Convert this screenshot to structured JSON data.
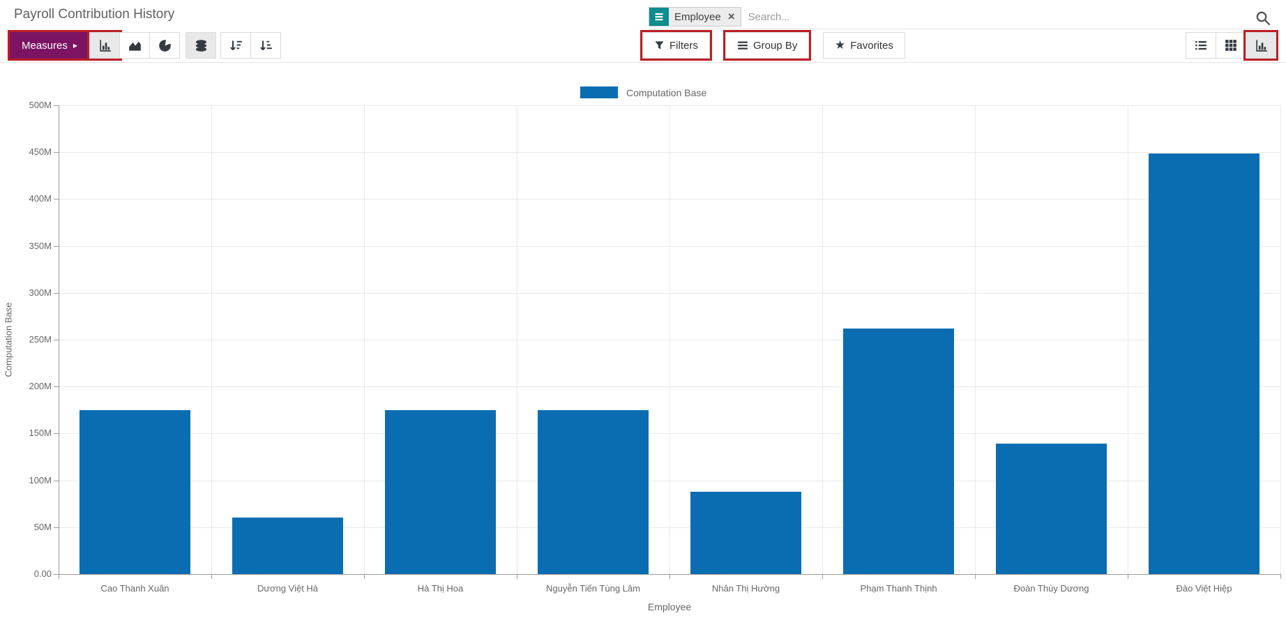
{
  "header": {
    "title": "Payroll Contribution History",
    "search": {
      "facet": {
        "label": "Employee",
        "remove": "×"
      },
      "placeholder": "Search..."
    }
  },
  "toolbar": {
    "measures": {
      "label": "Measures",
      "caret": "▸"
    }
  },
  "filter_bar": {
    "filters": "Filters",
    "group_by": "Group By",
    "favorites": "Favorites"
  },
  "view_switcher": {
    "views": [
      "list",
      "pivot",
      "graph"
    ],
    "active": "graph"
  },
  "icons": {
    "facet-group-by-icon": "white hamburger lines on teal square",
    "remove-x-icon": "×",
    "magnifier-icon": "svg magnifier",
    "measures-caret-icon": "▸",
    "bar-chart-type-icon": "svg bars with axis",
    "area-chart-type-icon": "svg filled mountain",
    "pie-chart-type-icon": "svg pie with notch",
    "stacked-icon": "svg database discs",
    "sort-desc-icon": "svg down arrow + shrinking bars",
    "sort-asc-icon": "svg down arrow + growing bars",
    "filter-funnel-icon": "svg funnel",
    "group-by-lines-icon": "svg hamburger lines",
    "favorites-star-icon": "★",
    "list-view-icon": "svg bulleted list",
    "pivot-view-icon": "svg grid",
    "graph-view-icon": "svg bars with axis"
  },
  "colors": {
    "accent_purple": "#7c1463",
    "highlight_red": "#bc1e24",
    "facet_teal": "#0c8c8f",
    "bar_blue": "#0a6db2"
  },
  "highlighted_elements": [
    "measures-button",
    "bar-chart-type-button",
    "filters-button",
    "group-by-button",
    "graph-view-button"
  ],
  "chart_data": {
    "type": "bar",
    "title": "",
    "legend": [
      "Computation Base"
    ],
    "legend_position": "top",
    "xlabel": "Employee",
    "ylabel": "Computation Base",
    "categories": [
      "Cao Thanh Xuân",
      "Dương Việt Hà",
      "Hà Thị Hoa",
      "Nguyễn Tiến Tùng Lâm",
      "Nhân Thị Hường",
      "Phạm Thanh Thịnh",
      "Đoàn Thùy Dương",
      "Đào Việt Hiệp"
    ],
    "series": [
      {
        "name": "Computation Base",
        "color": "#0a6db2",
        "values_millions": [
          175,
          60,
          175,
          175,
          88,
          262,
          139,
          449
        ]
      }
    ],
    "ylim_millions": [
      0,
      500
    ],
    "y_tick_labels_top_to_bottom": [
      "500M",
      "450M",
      "400M",
      "350M",
      "300M",
      "250M",
      "200M",
      "150M",
      "100M",
      "50M",
      "0.00"
    ],
    "grid": true
  }
}
